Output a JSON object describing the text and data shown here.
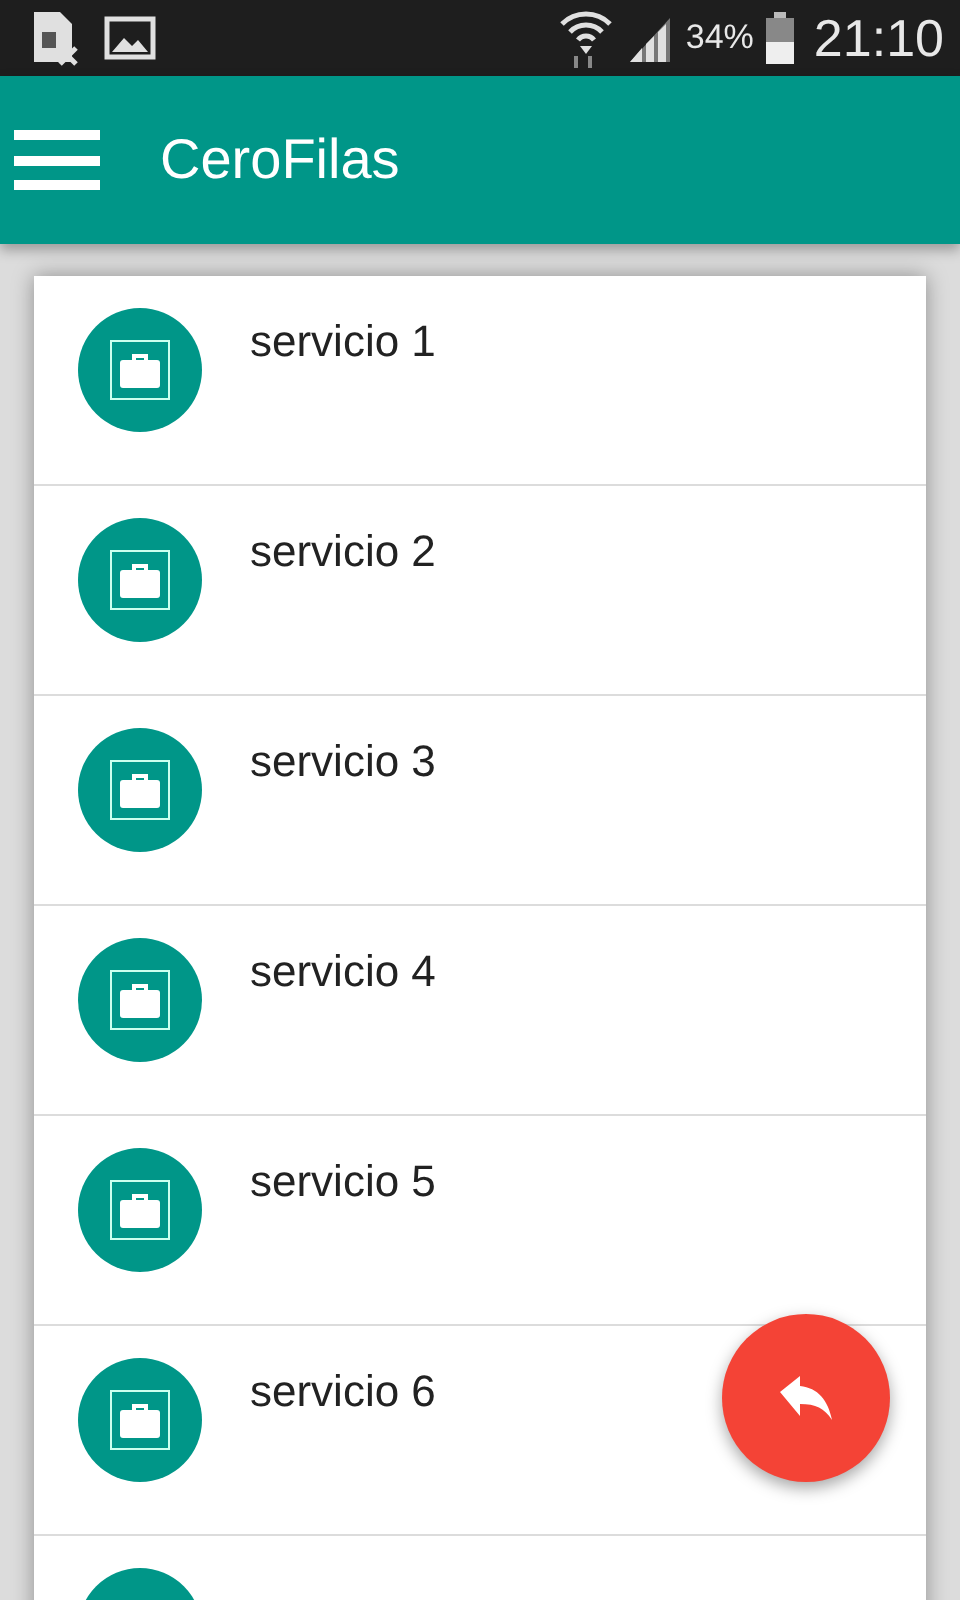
{
  "status_bar": {
    "battery": "34%",
    "time": "21:10"
  },
  "app_bar": {
    "title": "CeroFilas"
  },
  "services": [
    {
      "name": "servicio 1"
    },
    {
      "name": "servicio 2"
    },
    {
      "name": "servicio 3"
    },
    {
      "name": "servicio 4"
    },
    {
      "name": "servicio 5"
    },
    {
      "name": "servicio 6"
    }
  ],
  "more_below": true
}
